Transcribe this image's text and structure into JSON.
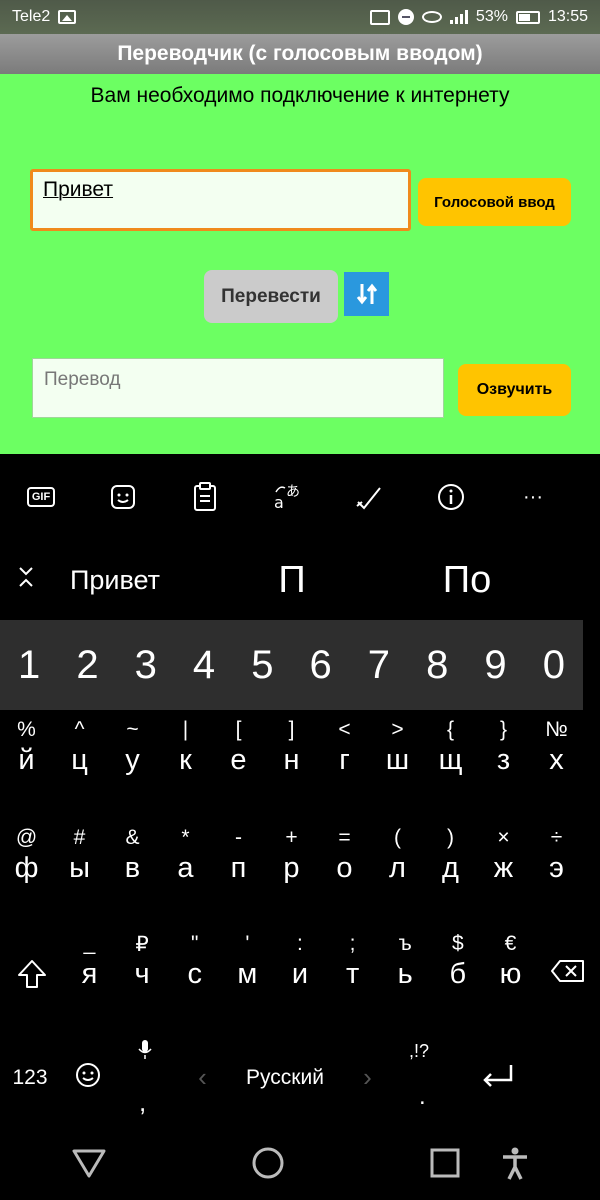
{
  "status_bar": {
    "carrier": "Tele2",
    "battery": "53%",
    "time": "13:55"
  },
  "app": {
    "title": "Переводчик (с голосовым вводом)",
    "notice": "Вам необходимо подключение к интернету",
    "input_value": "Привет",
    "voice_label": "Голосовой ввод",
    "translate_label": "Перевести",
    "output_placeholder": "Перевод",
    "speak_label": "Озвучить"
  },
  "keyboard": {
    "toolbar": [
      "gif-icon",
      "sticker-icon",
      "clipboard-icon",
      "translate-icon",
      "draw-icon",
      "info-icon",
      "more-icon"
    ],
    "gif_label": "GIF",
    "more_label": "···",
    "suggestions": [
      "Привет",
      "П",
      "По"
    ],
    "numbers": [
      "1",
      "2",
      "3",
      "4",
      "5",
      "6",
      "7",
      "8",
      "9",
      "0"
    ],
    "row1": {
      "secondary": [
        "%",
        "^",
        "~",
        "|",
        "[",
        "]",
        "<",
        ">",
        "{",
        "}",
        "№"
      ],
      "primary": [
        "й",
        "ц",
        "у",
        "к",
        "е",
        "н",
        "г",
        "ш",
        "щ",
        "з",
        "х"
      ]
    },
    "row2": {
      "secondary": [
        "@",
        "#",
        "&",
        "*",
        "-",
        "+",
        "=",
        "(",
        ")",
        "×",
        "÷"
      ],
      "primary": [
        "ф",
        "ы",
        "в",
        "а",
        "п",
        "р",
        "о",
        "л",
        "д",
        "ж",
        "э"
      ]
    },
    "row3": {
      "secondary": [
        "_",
        "₽",
        "\"",
        "'",
        ":",
        ";",
        "ъ",
        "$",
        "€"
      ],
      "primary": [
        "я",
        "ч",
        "с",
        "м",
        "и",
        "т",
        "ь",
        "б",
        "ю"
      ]
    },
    "bottom": {
      "symbols": "123",
      "comma": ",",
      "language": "Русский",
      "punct_top": ",!?",
      "period": "."
    }
  },
  "colors": {
    "app_background": "#6cff62",
    "accent_button": "#ffc400",
    "input_border": "#f08a1c",
    "swap_button": "#2a98de"
  }
}
